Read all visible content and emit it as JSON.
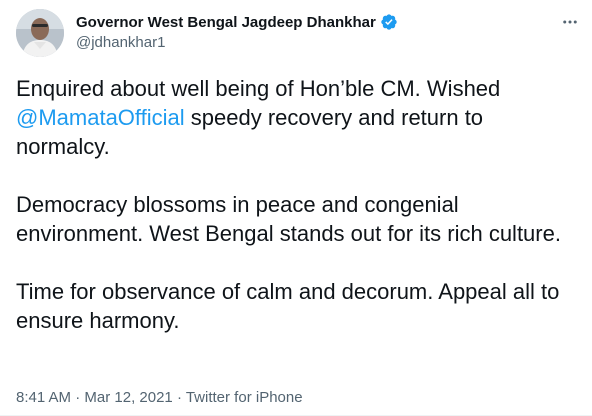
{
  "author": {
    "display_name": "Governor West Bengal Jagdeep Dhankhar",
    "handle": "@jdhankhar1",
    "verified_icon": "verified-badge-icon",
    "avatar_icon": "avatar"
  },
  "tweet": {
    "para1_before": "Enquired about well being of Hon’ble CM. Wished ",
    "mention": "@MamataOfficial",
    "para1_after": " speedy recovery and return to normalcy.",
    "para2": "Democracy blossoms in peace and congenial environment. West Bengal stands out for its rich culture.",
    "para3": "Time for observance of calm and decorum. Appeal all to ensure harmony."
  },
  "meta": {
    "time": "8:41 AM",
    "separator": " · ",
    "date": "Mar 12, 2021",
    "source": "Twitter for iPhone"
  },
  "colors": {
    "accent": "#1d9bf0",
    "text": "#0f1419",
    "secondary": "#536471"
  }
}
